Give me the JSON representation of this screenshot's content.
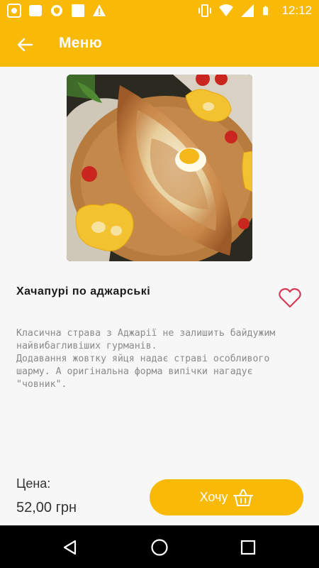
{
  "status_bar": {
    "time": "12:12",
    "icons_left": [
      "screenshot-icon",
      "square-app-icon",
      "vpn-shield-icon",
      "square-app-icon",
      "warning-icon"
    ],
    "icons_right": [
      "vibrate-icon",
      "wifi-icon",
      "signal-icon",
      "battery-icon"
    ]
  },
  "header": {
    "title": "Меню",
    "back_icon": "arrow-left-icon"
  },
  "dish": {
    "title": "Хачапурі по аджарські",
    "description": [
      "Класична страва з Аджарії не залишить байдужим найвибагливіших гурманів.",
      "Додавання жовтку яйця надає страві особливого шарму. А оригінальна форма випічки нагадує \"човник\"."
    ],
    "favorite_icon": "heart-outline-icon"
  },
  "price": {
    "label": "Цена:",
    "value": "52,00 грн"
  },
  "action": {
    "label": "Хочу",
    "icon": "basket-icon"
  },
  "navigation": {
    "buttons": [
      "back-triangle-icon",
      "home-circle-icon",
      "recents-square-icon"
    ]
  },
  "colors": {
    "accent": "#f9b907",
    "heart": "#d33a55"
  }
}
